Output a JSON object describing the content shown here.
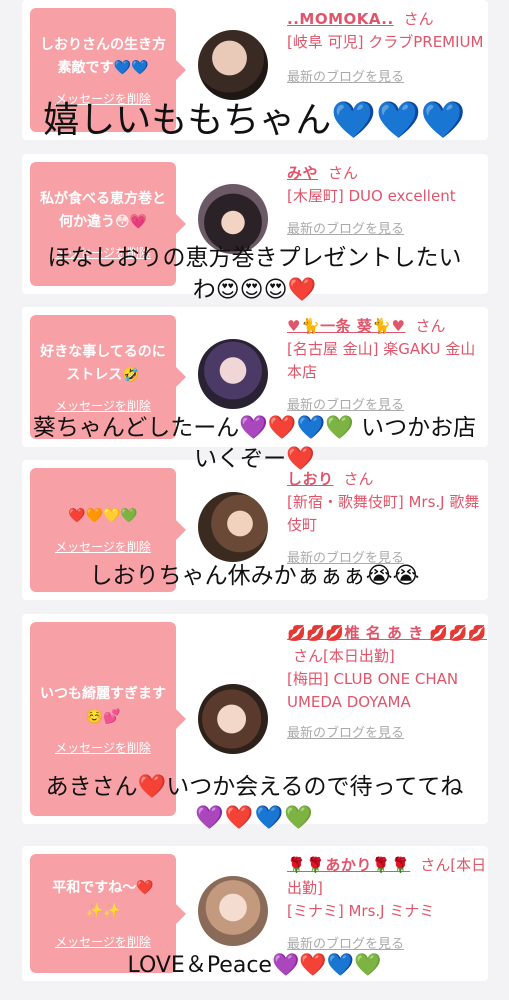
{
  "delete_label": "メッセージを削除",
  "blog_label": "最新のブログを見る",
  "cards": [
    {
      "message": "しおりさんの生き方素敵です💙💙",
      "name": "..MOMOKA..",
      "suffix": "さん",
      "location": "[岐阜 可児] クラブPREMIUM"
    },
    {
      "message": "私が食べる恵方巻と何か違う😳💗",
      "name": "みや",
      "suffix": "さん",
      "location": "[木屋町] DUO excellent"
    },
    {
      "message": "好きな事してるのにストレス🤣",
      "name": "♥🐈一条 葵🐈♥",
      "suffix": "さん",
      "location": "[名古屋 金山] 楽GAKU 金山本店"
    },
    {
      "message": "❤️🧡💛💚",
      "name": "しおり",
      "suffix": "さん",
      "location": "[新宿・歌舞伎町] Mrs.J 歌舞伎町"
    },
    {
      "message": "いつも綺麗すぎます☺️💕",
      "name": "💋💋💋椎 名 あ き 💋💋💋",
      "suffix": "さん[本日出勤]",
      "location": "[梅田] CLUB ONE CHAN UMEDA DOYAMA"
    },
    {
      "message": "平和ですね〜❤️ ✨✨",
      "name": "🌹🌹あかり🌹🌹",
      "suffix": "さん[本日出勤]",
      "location": "[ミナミ] Mrs.J ミナミ"
    }
  ],
  "overlays": [
    "嬉しいももちゃん💙💙💙",
    "ほなしおりの恵方巻きプレゼントしたい",
    "わ😍😍😍❤️",
    "葵ちゃんどしたーん💜❤️💙💚 いつかお店",
    "いくぞー❤️",
    "しおりちゃん休みかぁぁぁ😭😭",
    "あきさん❤️いつか会えるので待っててね",
    "💜❤️💙💚",
    "LOVE＆Peace💜❤️💙💚"
  ]
}
